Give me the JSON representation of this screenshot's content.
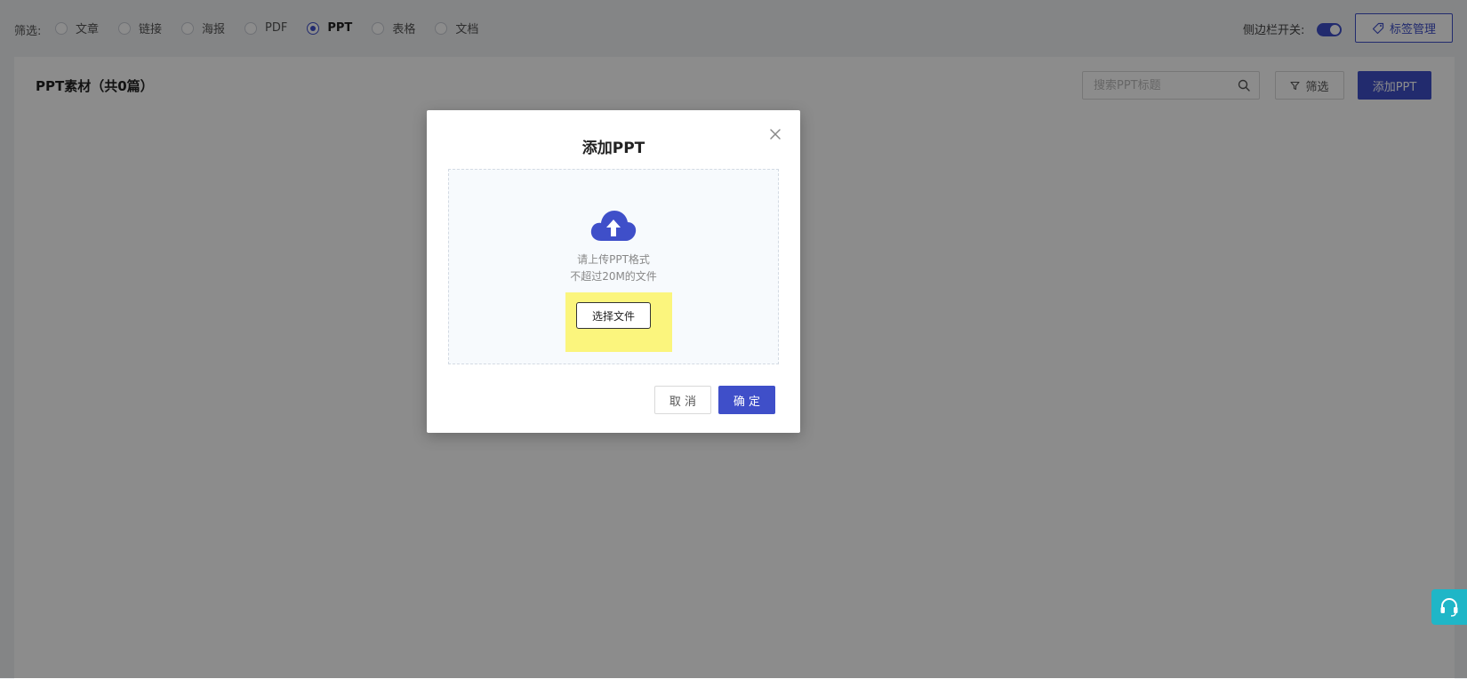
{
  "filter": {
    "label": "筛选:",
    "options": [
      {
        "label": "文章",
        "checked": false
      },
      {
        "label": "链接",
        "checked": false
      },
      {
        "label": "海报",
        "checked": false
      },
      {
        "label": "PDF",
        "checked": false
      },
      {
        "label": "PPT",
        "checked": true
      },
      {
        "label": "表格",
        "checked": false
      },
      {
        "label": "文档",
        "checked": false
      }
    ]
  },
  "header": {
    "sidebar_switch_label": "侧边栏开关:",
    "sidebar_switch_on": true,
    "tag_manage_label": "标签管理"
  },
  "panel": {
    "title": "PPT素材（共0篇）",
    "search_placeholder": "搜索PPT标题",
    "filter_label": "筛选",
    "add_label": "添加PPT"
  },
  "modal": {
    "title": "添加PPT",
    "hint_line1": "请上传PPT格式",
    "hint_line2": "不超过20M的文件",
    "choose_file_label": "选择文件",
    "cancel_label": "取 消",
    "ok_label": "确 定"
  },
  "colors": {
    "primary": "#3f4fc9",
    "highlight": "#fbf57d",
    "service": "#1fb6c7"
  },
  "icons": {
    "tag": "tag-icon",
    "search": "search-icon",
    "filter": "funnel-icon",
    "close": "close-icon",
    "upload": "cloud-upload-icon",
    "service": "headset-icon"
  }
}
